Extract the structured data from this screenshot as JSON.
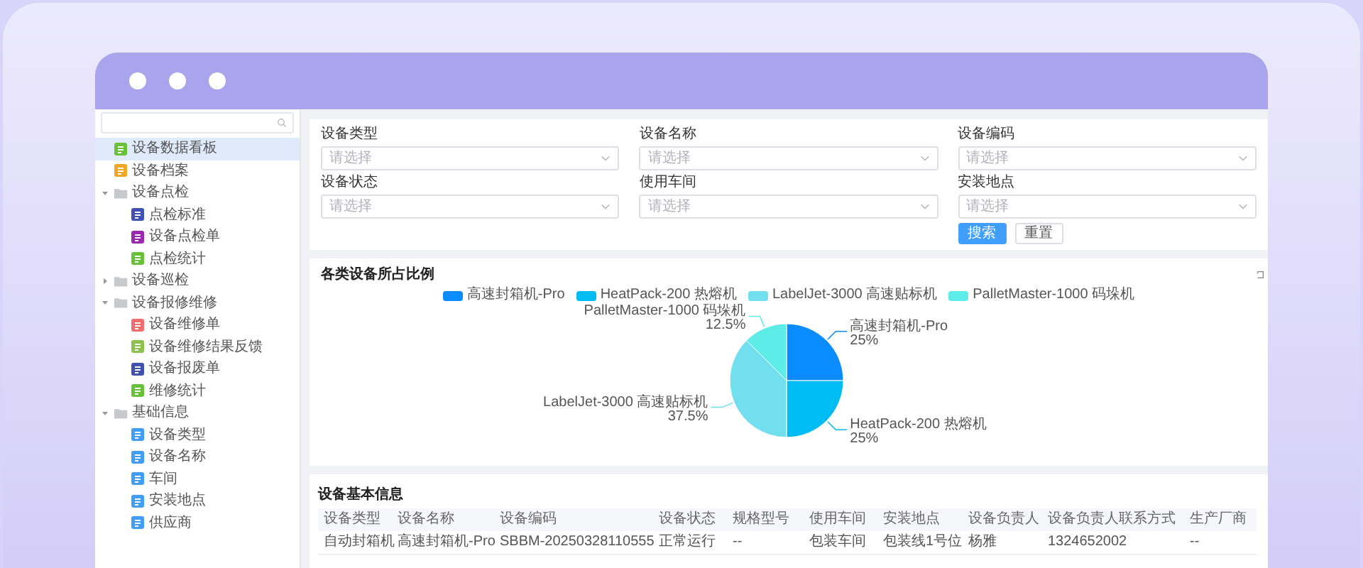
{
  "sidebar": {
    "items": [
      {
        "label": "设备数据看板",
        "kind": "page",
        "color": "#67c23a",
        "selected": true
      },
      {
        "label": "设备档案",
        "kind": "page",
        "color": "#f5a623",
        "selected": false
      },
      {
        "label": "设备点检",
        "kind": "folder",
        "expanded": true,
        "selected": false,
        "children": [
          {
            "label": "点检标准",
            "kind": "page",
            "color": "#3f51b5",
            "selected": false
          },
          {
            "label": "设备点检单",
            "kind": "page",
            "color": "#9c27b0",
            "selected": false
          },
          {
            "label": "点检统计",
            "kind": "page",
            "color": "#67c23a",
            "selected": false
          }
        ]
      },
      {
        "label": "设备巡检",
        "kind": "folder",
        "expanded": false,
        "selected": false
      },
      {
        "label": "设备报修维修",
        "kind": "folder",
        "expanded": true,
        "selected": false,
        "children": [
          {
            "label": "设备维修单",
            "kind": "page",
            "color": "#f56c6c",
            "selected": false
          },
          {
            "label": "设备维修结果反馈",
            "kind": "page",
            "color": "#8bc34a",
            "selected": false
          },
          {
            "label": "设备报废单",
            "kind": "page",
            "color": "#3f51b5",
            "selected": false
          },
          {
            "label": "维修统计",
            "kind": "page",
            "color": "#67c23a",
            "selected": false
          }
        ]
      },
      {
        "label": "基础信息",
        "kind": "folder",
        "expanded": true,
        "selected": false,
        "children": [
          {
            "label": "设备类型",
            "kind": "page",
            "color": "#409eff",
            "selected": false
          },
          {
            "label": "设备名称",
            "kind": "page",
            "color": "#409eff",
            "selected": false
          },
          {
            "label": "车间",
            "kind": "page",
            "color": "#409eff",
            "selected": false
          },
          {
            "label": "安装地点",
            "kind": "page",
            "color": "#409eff",
            "selected": false
          },
          {
            "label": "供应商",
            "kind": "page",
            "color": "#409eff",
            "selected": false
          }
        ]
      }
    ]
  },
  "filters": [
    {
      "label": "设备类型",
      "placeholder": "请选择"
    },
    {
      "label": "设备名称",
      "placeholder": "请选择"
    },
    {
      "label": "设备编码",
      "placeholder": "请选择"
    },
    {
      "label": "设备状态",
      "placeholder": "请选择"
    },
    {
      "label": "使用车间",
      "placeholder": "请选择"
    },
    {
      "label": "安装地点",
      "placeholder": "请选择"
    }
  ],
  "buttons": [
    {
      "label": "搜索",
      "kind": "primary"
    },
    {
      "label": "重置",
      "kind": "default"
    }
  ],
  "chart": {
    "chart_data": {
      "type": "pie",
      "title": "各类设备所占比例",
      "categories": [
        "高速封箱机-Pro",
        "HeatPack-200 热熔机",
        "LabelJet-3000 高速贴标机",
        "PalletMaster-1000 码垛机"
      ],
      "values": [
        25,
        25,
        37.5,
        12.5
      ],
      "data_labels": true,
      "value_labels": [
        "25%",
        "25%",
        "37.5%",
        "12.5%"
      ]
    }
  },
  "table": {
    "title": "设备基本信息",
    "columns": [
      "设备类型",
      "设备名称",
      "设备编码",
      "设备状态",
      "规格型号",
      "使用车间",
      "安装地点",
      "设备负责人",
      "设备负责人联系方式",
      "生产厂商"
    ],
    "rows": [
      [
        "自动封箱机",
        "高速封箱机-Pro",
        "SBBM-20250328110555",
        "正常运行",
        "--",
        "包装车间",
        "包装线1号位",
        "杨雅",
        "1324652002",
        "--"
      ]
    ]
  }
}
